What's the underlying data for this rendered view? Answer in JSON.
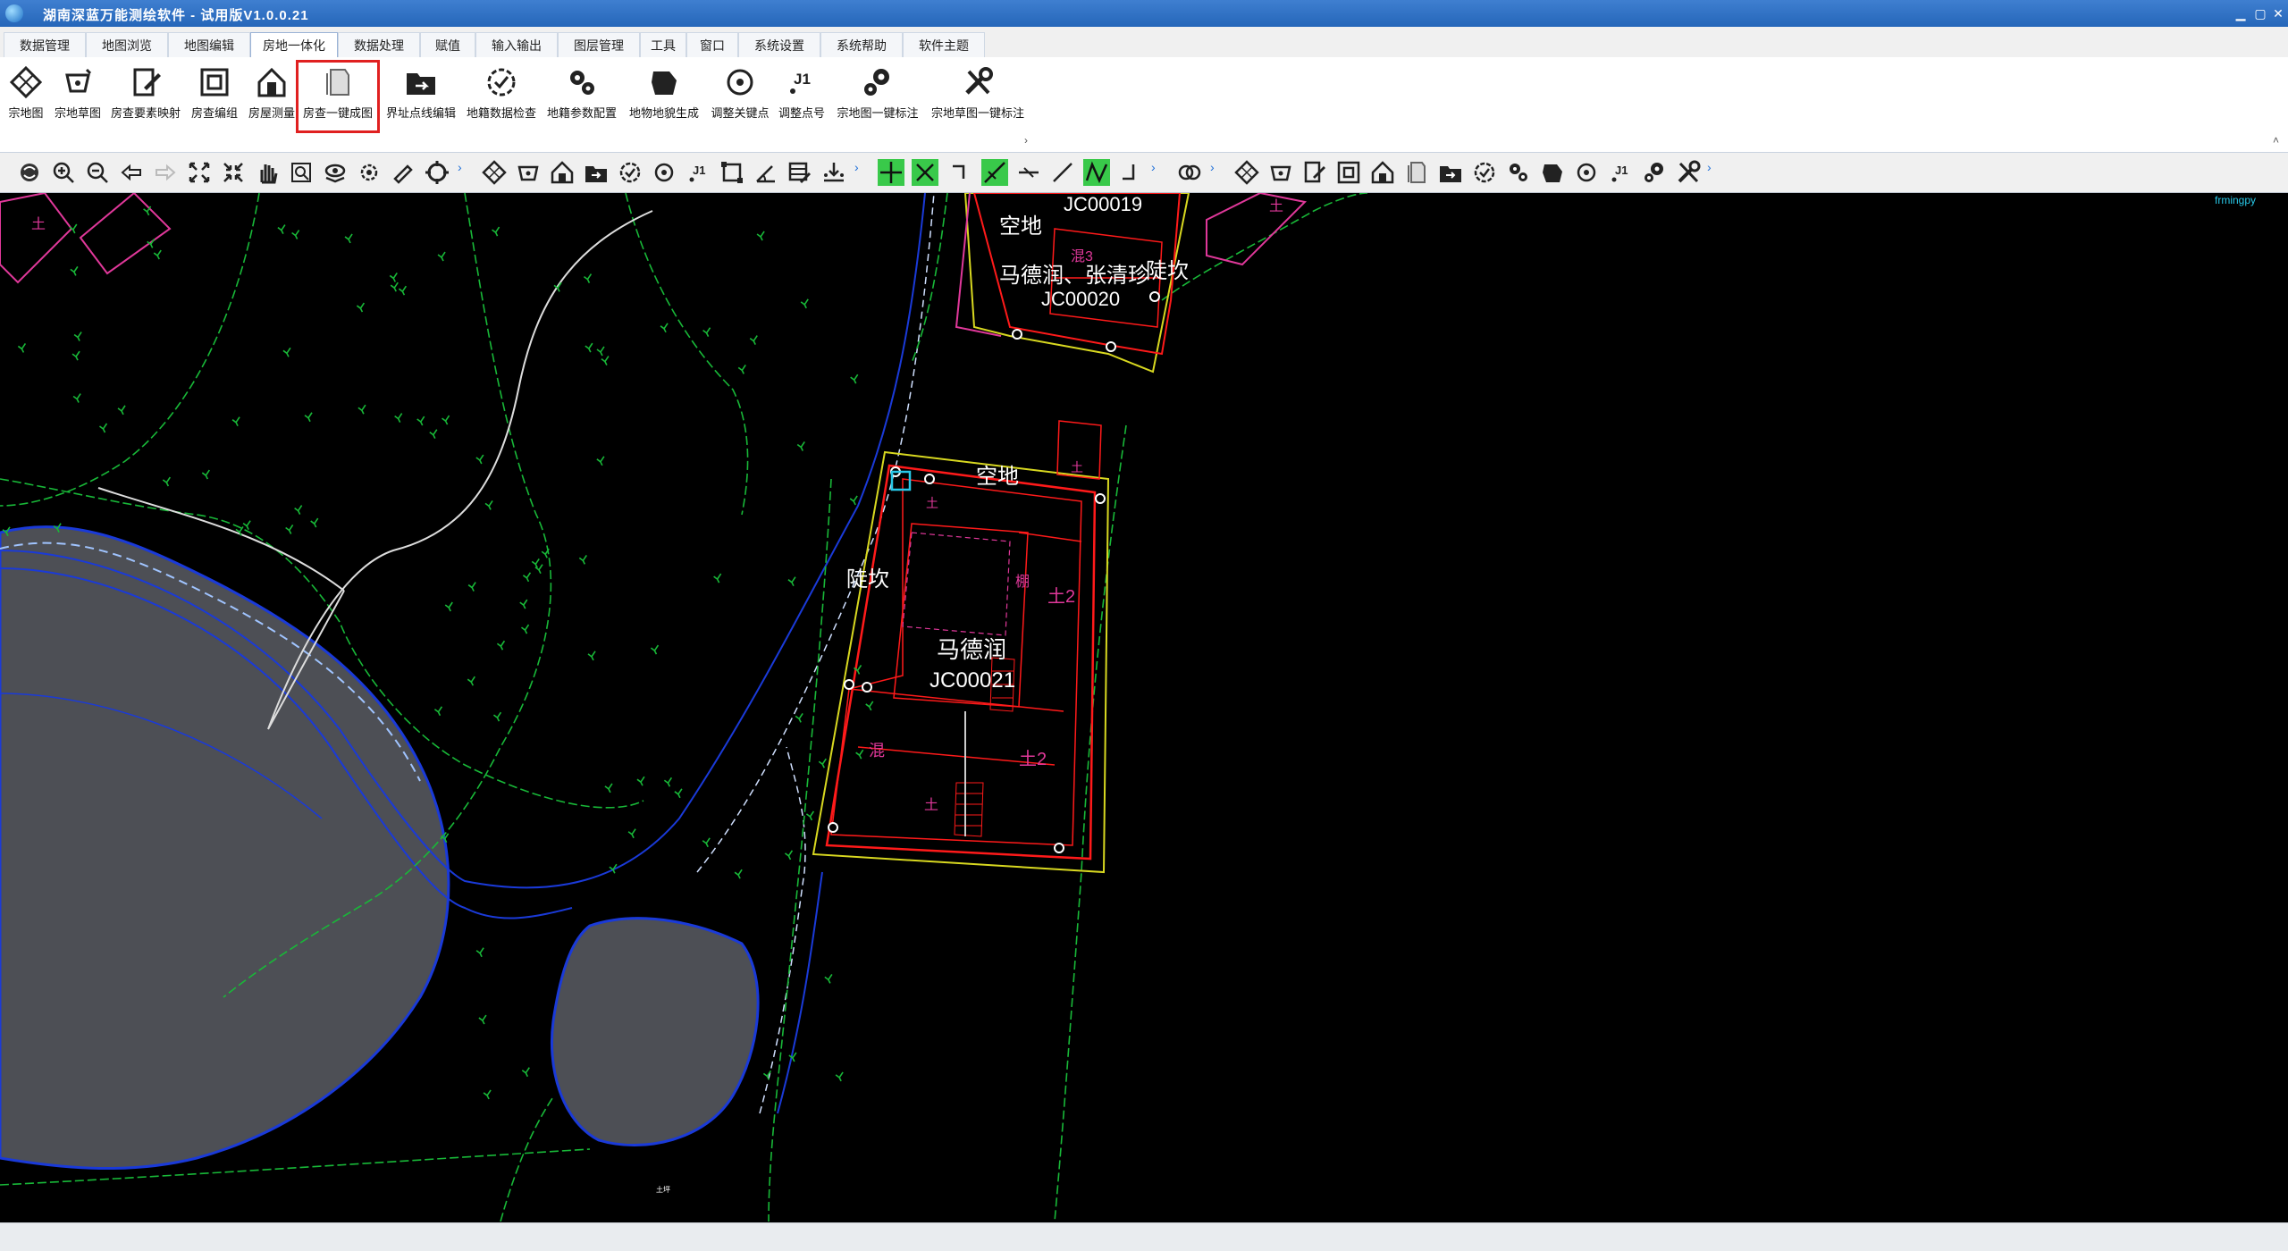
{
  "window": {
    "title": "湖南深蓝万能测绘软件 - 试用版V1.0.0.21"
  },
  "menu_tabs": [
    {
      "label": "数据管理"
    },
    {
      "label": "地图浏览"
    },
    {
      "label": "地图编辑"
    },
    {
      "label": "房地一体化"
    },
    {
      "label": "数据处理"
    },
    {
      "label": "赋值"
    },
    {
      "label": "输入输出"
    },
    {
      "label": "图层管理"
    },
    {
      "label": "工具"
    },
    {
      "label": "窗口"
    },
    {
      "label": "系统设置"
    },
    {
      "label": "系统帮助"
    },
    {
      "label": "软件主题"
    }
  ],
  "active_tab": "房地一体化",
  "ribbon": [
    {
      "label": "宗地图",
      "icon": "diamond-grid-icon"
    },
    {
      "label": "宗地草图",
      "icon": "sketch-crosshair-icon"
    },
    {
      "label": "房查要素映射",
      "icon": "edit-document-icon"
    },
    {
      "label": "房查编组",
      "icon": "group-frame-icon"
    },
    {
      "label": "房屋测量",
      "icon": "house-icon"
    },
    {
      "label": "房查一键成图",
      "icon": "document-stack-icon",
      "selected": true
    },
    {
      "label": "界址点线编辑",
      "icon": "folder-arrow-icon"
    },
    {
      "label": "地籍数据检查",
      "icon": "check-circle-icon"
    },
    {
      "label": "地籍参数配置",
      "icon": "gears-small-icon"
    },
    {
      "label": "地物地貌生成",
      "icon": "shape-blob-icon"
    },
    {
      "label": "调整关键点",
      "icon": "target-circle-icon"
    },
    {
      "label": "调整点号",
      "icon": "j1-icon"
    },
    {
      "label": "宗地图一键标注",
      "icon": "gears-icon"
    },
    {
      "label": "宗地草图一键标注",
      "icon": "tools-icon"
    }
  ],
  "map_labels": {
    "corner_text": "frmingpy",
    "parcel_a_id": "JC00019",
    "parcel_a_open": "空地",
    "parcel_a_owner": "马德润、张清珍",
    "parcel_a_id2": "JC00020",
    "parcel_a_slope": "陡坎",
    "parcel_b_open": "空地",
    "parcel_b_slope": "陡坎",
    "parcel_b_owner": "马德润",
    "parcel_b_id": "JC00021",
    "floor_a": "土2",
    "floor_b": "土2",
    "mixed_a": "混3",
    "mixed_b": "混",
    "earth_a": "土",
    "earth_b": "土",
    "earth_c": "土",
    "earth_d": "土",
    "earth_e": "土",
    "porch": "棚",
    "lane": "土坪"
  },
  "colors": {
    "accent": "#2566b9",
    "selection": "#e02020",
    "parcel_red": "#ff1a1a",
    "parcel_yellow": "#d8d820",
    "veg_green": "#18b838",
    "water_blue": "#1a3ad8",
    "pond_gray": "#4d4f55"
  }
}
